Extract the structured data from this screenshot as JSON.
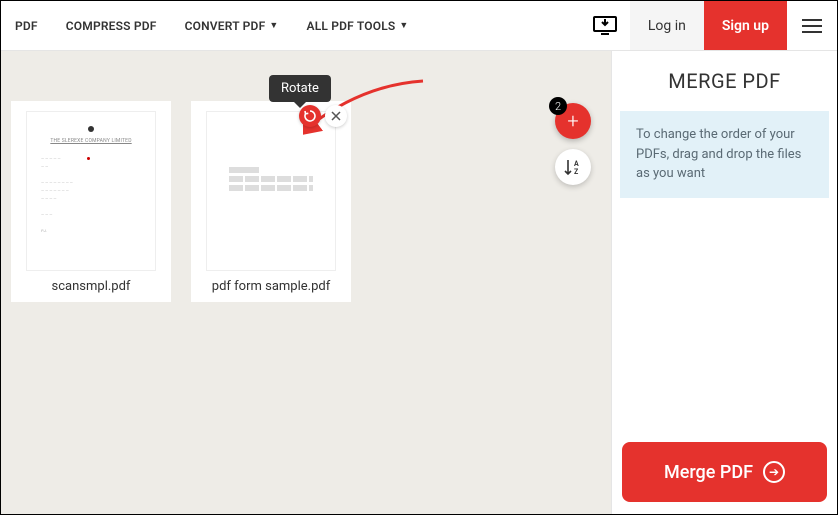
{
  "nav": {
    "items": [
      "PDF",
      "COMPRESS PDF",
      "CONVERT PDF",
      "ALL PDF TOOLS"
    ]
  },
  "auth": {
    "login": "Log in",
    "signup": "Sign up"
  },
  "tooltip": "Rotate",
  "files": [
    {
      "name": "scansmpl.pdf"
    },
    {
      "name": "pdf form sample.pdf"
    }
  ],
  "add": {
    "count": "2"
  },
  "sort_label": "A\nZ",
  "sidebar": {
    "title": "MERGE PDF",
    "hint": "To change the order of your PDFs, drag and drop the files as you want",
    "action": "Merge PDF"
  }
}
